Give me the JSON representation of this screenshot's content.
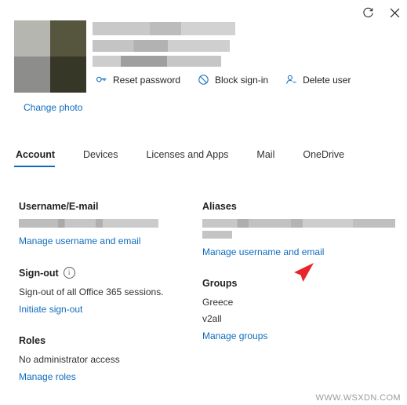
{
  "window": {
    "refresh_icon": "refresh-icon",
    "close_icon": "close-icon"
  },
  "header": {
    "change_photo": "Change photo",
    "commands": [
      {
        "label": "Reset password",
        "icon": "key-icon"
      },
      {
        "label": "Block sign-in",
        "icon": "block-icon"
      },
      {
        "label": "Delete user",
        "icon": "delete-user-icon"
      }
    ]
  },
  "tabs": [
    {
      "label": "Account",
      "active": true
    },
    {
      "label": "Devices",
      "active": false
    },
    {
      "label": "Licenses and Apps",
      "active": false
    },
    {
      "label": "Mail",
      "active": false
    },
    {
      "label": "OneDrive",
      "active": false
    }
  ],
  "left_column": {
    "username_section": {
      "title": "Username/E-mail",
      "link": "Manage username and email"
    },
    "signout_section": {
      "title": "Sign-out",
      "info_icon": "info-icon",
      "description": "Sign-out of all Office 365 sessions.",
      "link": "Initiate sign-out"
    },
    "roles_section": {
      "title": "Roles",
      "description": "No administrator access",
      "link": "Manage roles"
    }
  },
  "right_column": {
    "aliases_section": {
      "title": "Aliases",
      "link": "Manage username and email"
    },
    "groups_section": {
      "title": "Groups",
      "items": [
        "Greece",
        "v2all"
      ],
      "link": "Manage groups"
    }
  },
  "watermark": "WWW.WSXDN.COM"
}
